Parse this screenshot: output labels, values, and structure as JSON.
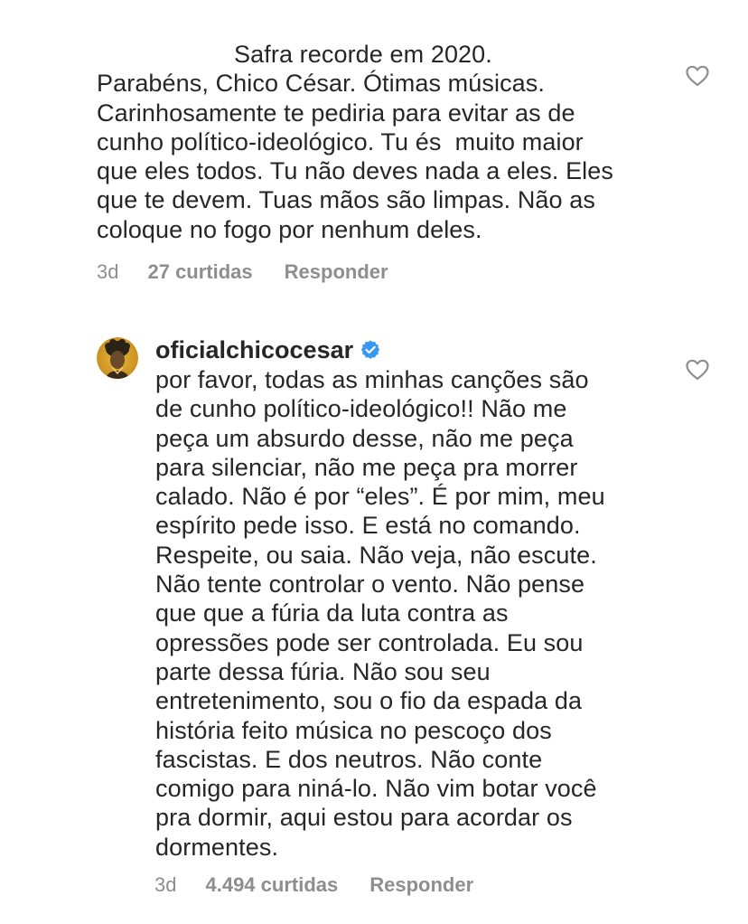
{
  "comment1": {
    "text": "                    Safra recorde em 2020. \nParabéns, Chico César. Ótimas músicas.\nCarinhosamente te pediria para evitar as de\ncunho político-ideológico. Tu és  muito maior\nque eles todos. Tu não deves nada a eles. Eles\nque te devem. Tuas mãos são limpas. Não as\ncoloque no fogo por nenhum deles.",
    "time": "3d",
    "likes": "27 curtidas",
    "reply": "Responder",
    "heart_icon": "heart-outline-icon"
  },
  "comment2": {
    "username": "oficialchicocesar",
    "verified_icon": "verified-badge-icon",
    "text": "por favor, todas as minhas canções são\nde cunho político-ideológico!! Não me\npeça um absurdo desse, não me peça\npara silenciar, não me peça pra morrer\ncalado. Não é por “eles”. É por mim, meu\nespírito pede isso. E está no comando.\nRespeite, ou saia. Não veja, não escute.\nNão tente controlar o vento. Não pense\nque que a fúria da luta contra as\nopressões pode ser controlada. Eu sou\nparte dessa fúria. Não sou seu\nentretenimento, sou o fio da espada da\nhistória feito música no pescoço dos\nfascistas. E dos neutros. Não conte\ncomigo para niná-lo. Não vim botar você\npra dormir, aqui estou para acordar os\ndormentes.",
    "time": "3d",
    "likes": "4.494 curtidas",
    "reply": "Responder",
    "heart_icon": "heart-outline-icon"
  },
  "colors": {
    "text": "#262626",
    "meta": "#8e8e8e",
    "verified": "#3897f0"
  }
}
